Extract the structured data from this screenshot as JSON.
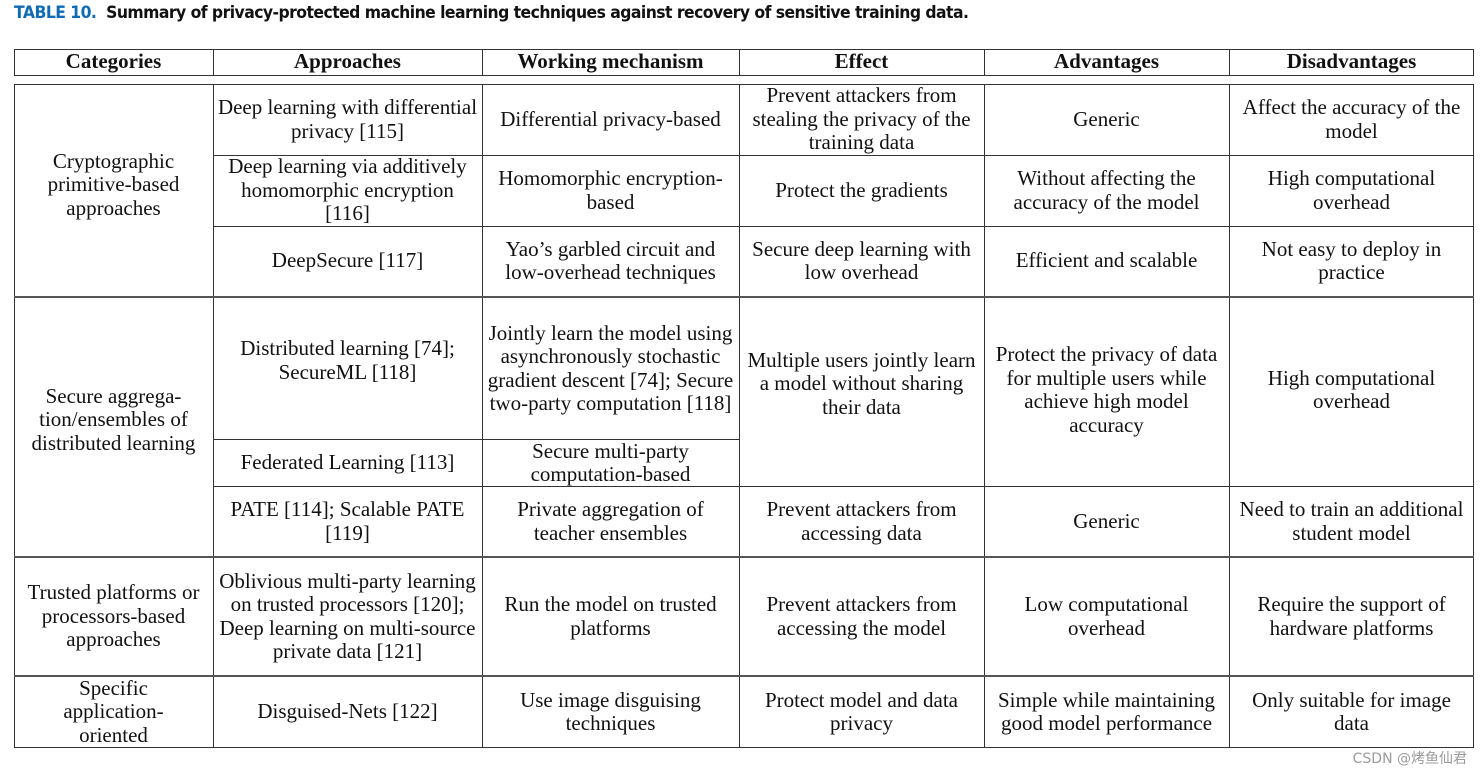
{
  "title": {
    "label": "TABLE 10.",
    "caption": "Summary of privacy-protected machine learning techniques against recovery of sensitive training data."
  },
  "columns": [
    "Categories",
    "Approaches",
    "Working mechanism",
    "Effect",
    "Advantages",
    "Disadvantages"
  ],
  "groups": [
    {
      "category": "Cryptographic primitive-based approaches",
      "rows": [
        {
          "approach": "Deep learning with differential privacy [115]",
          "mechanism": "Differential privacy-based",
          "effect": "Prevent attackers from stealing the privacy of the training data",
          "advantages": "Generic",
          "disadvantages": "Affect the accuracy of the model"
        },
        {
          "approach": "Deep learning via additively homomorphic encryption [116]",
          "mechanism": "Homomorphic encryption-based",
          "effect": "Protect the gradients",
          "advantages": "Without affecting the accuracy of the model",
          "disadvantages": "High computational overhead"
        },
        {
          "approach": "DeepSecure [117]",
          "mechanism": "Yao’s garbled circuit and low-overhead techniques",
          "effect": "Secure deep learning with low overhead",
          "advantages": "Efficient and scalable",
          "disadvantages": "Not easy to deploy in practice"
        }
      ]
    },
    {
      "category": "Secure aggrega-tion/ensembles of distributed learning",
      "rows": [
        {
          "approach": "Distributed learning [74]; SecureML [118]",
          "mechanism": "Jointly learn the model using asynchronously stochastic gradient descent [74]; Secure two-party computation [118]"
        },
        {
          "approach": "Federated Learning [113]",
          "mechanism": "Secure multi-party computation-based"
        },
        {
          "approach": "PATE [114]; Scalable PATE [119]",
          "mechanism": "Private aggregation of teacher ensembles",
          "effect": "Prevent attackers from accessing data",
          "advantages": "Generic",
          "disadvantages": "Need to train an additional student model"
        }
      ],
      "merged": {
        "effect": "Multiple users jointly learn a model without sharing their data",
        "advantages": "Protect the privacy of data for multiple users while achieve high model accuracy",
        "disadvantages": "High computational overhead"
      }
    },
    {
      "category": "Trusted platforms or processors-based approaches",
      "rows": [
        {
          "approach": "Oblivious multi-party learning on trusted processors [120]; Deep learning on multi-source private data [121]",
          "mechanism": "Run the model on trusted platforms",
          "effect": "Prevent attackers from accessing the model",
          "advantages": "Low computational overhead",
          "disadvantages": "Require the support of hardware platforms"
        }
      ]
    },
    {
      "category": "Specific application-oriented",
      "rows": [
        {
          "approach": "Disguised-Nets [122]",
          "mechanism": "Use image disguising techniques",
          "effect": "Protect model and data privacy",
          "advantages": "Simple while maintaining good model performance",
          "disadvantages": "Only suitable for image data"
        }
      ]
    }
  ],
  "watermark": "CSDN @烤鱼仙君"
}
